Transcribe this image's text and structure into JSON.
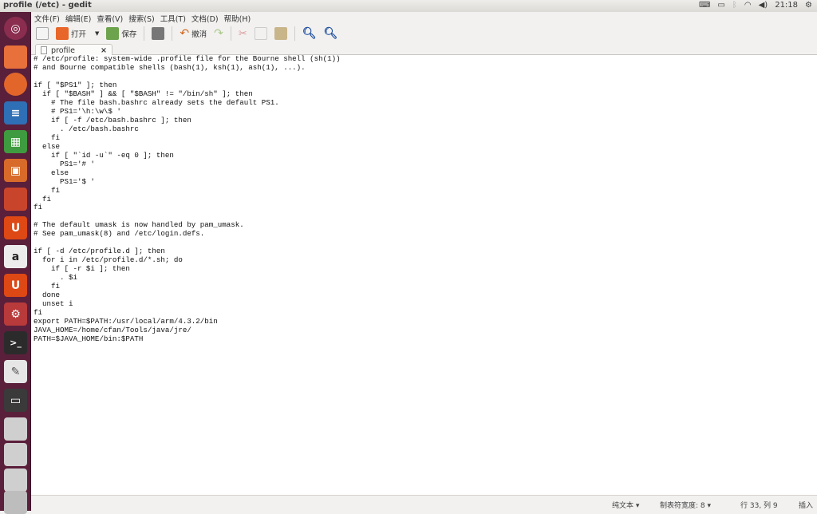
{
  "window_title": "profile (/etc) - gedit",
  "panel": {
    "clock": "21:18"
  },
  "menu": [
    "文件(F)",
    "编辑(E)",
    "查看(V)",
    "搜索(S)",
    "工具(T)",
    "文档(D)",
    "帮助(H)"
  ],
  "toolbar": {
    "open": "打开",
    "save": "保存",
    "undo": "撤消"
  },
  "tab": {
    "label": "profile",
    "close": "×"
  },
  "lines": [
    "# /etc/profile: system-wide .profile file for the Bourne shell (sh(1))",
    "# and Bourne compatible shells (bash(1), ksh(1), ash(1), ...).",
    "",
    "if [ \"$PS1\" ]; then",
    "  if [ \"$BASH\" ] && [ \"$BASH\" != \"/bin/sh\" ]; then",
    "    # The file bash.bashrc already sets the default PS1.",
    "    # PS1='\\h:\\w\\$ '",
    "    if [ -f /etc/bash.bashrc ]; then",
    "      . /etc/bash.bashrc",
    "    fi",
    "  else",
    "    if [ \"`id -u`\" -eq 0 ]; then",
    "      PS1='# '",
    "    else",
    "      PS1='$ '",
    "    fi",
    "  fi",
    "fi",
    "",
    "# The default umask is now handled by pam_umask.",
    "# See pam_umask(8) and /etc/login.defs.",
    "",
    "if [ -d /etc/profile.d ]; then",
    "  for i in /etc/profile.d/*.sh; do",
    "    if [ -r $i ]; then",
    "      . $i",
    "    fi",
    "  done",
    "  unset i",
    "fi",
    "export PATH=$PATH:/usr/local/arm/4.3.2/bin",
    "JAVA_HOME=/home/cfan/Tools/java/jre/",
    "PATH=$JAVA_HOME/bin:$PATH"
  ],
  "status": {
    "language": "纯文本 ▾",
    "tab_width": "制表符宽度: 8 ▾",
    "position": "行 33, 列 9",
    "mode": "插入"
  }
}
